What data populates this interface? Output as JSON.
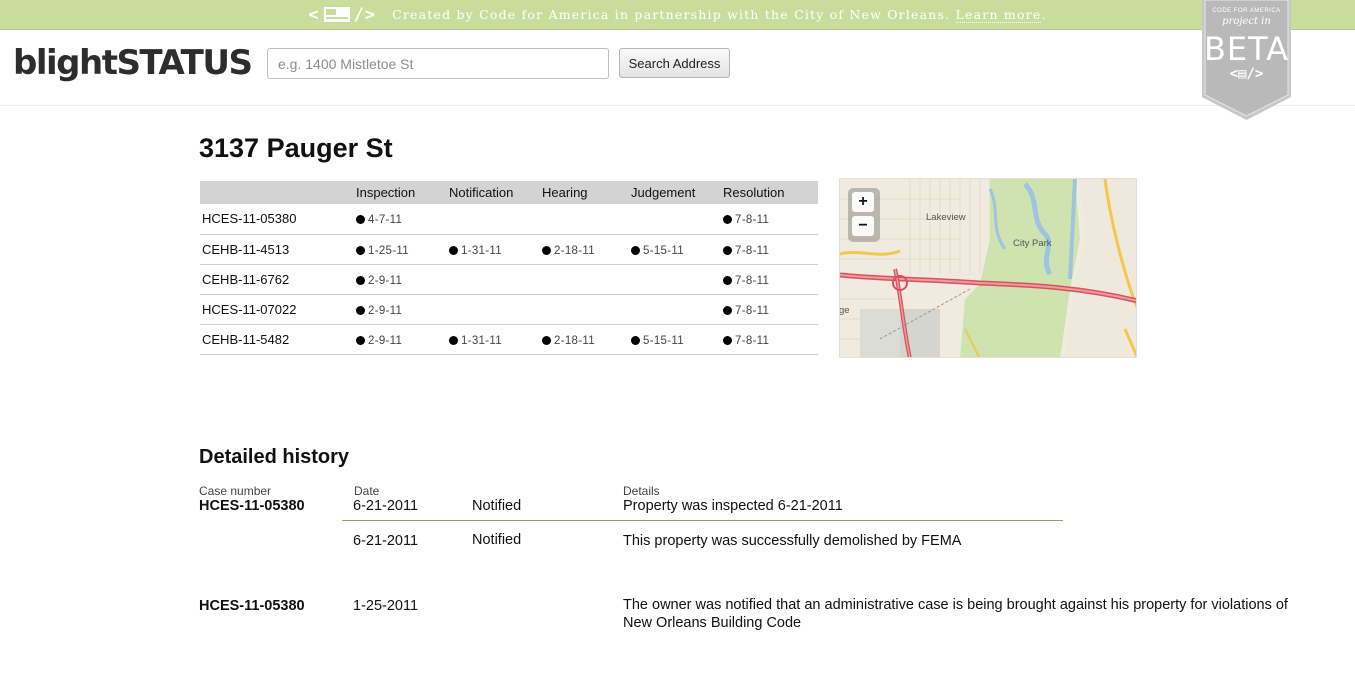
{
  "banner": {
    "tagline_text": "Created by Code for America in partnership with the City of New Orleans.",
    "learn_more": "Learn more",
    "period": ".",
    "color": "#c8dd9c"
  },
  "header": {
    "logo": "blightSTATUS",
    "search_placeholder": "e.g. 1400 Mistletoe St",
    "search_button": "Search Address"
  },
  "beta_badge": {
    "line1": "CODE FOR AMERICA",
    "line2": "project in",
    "line3": "BETA"
  },
  "address": "3137 Pauger St",
  "status_table": {
    "headers": [
      "",
      "Inspection",
      "Notification",
      "Hearing",
      "Judgement",
      "Resolution"
    ],
    "rows": [
      {
        "case": "HCES-11-05380",
        "steps": [
          "4-7-11",
          "",
          "",
          "",
          "7-8-11"
        ]
      },
      {
        "case": "CEHB-11-4513",
        "steps": [
          "1-25-11",
          "1-31-11",
          "2-18-11",
          "5-15-11",
          "7-8-11"
        ]
      },
      {
        "case": "CEHB-11-6762",
        "steps": [
          "2-9-11",
          "",
          "",
          "",
          "7-8-11"
        ]
      },
      {
        "case": "HCES-11-07022",
        "steps": [
          "2-9-11",
          "",
          "",
          "",
          "7-8-11"
        ]
      },
      {
        "case": "CEHB-11-5482",
        "steps": [
          "2-9-11",
          "1-31-11",
          "2-18-11",
          "5-15-11",
          "7-8-11"
        ]
      }
    ]
  },
  "map": {
    "labels": {
      "lakeview": "Lakeview",
      "city_park": "City Park",
      "edge": "ge"
    },
    "zoom_in": "+",
    "zoom_out": "−"
  },
  "history": {
    "title": "Detailed history",
    "col_case": "Case number",
    "col_date": "Date",
    "col_details": "Details",
    "entries": [
      {
        "case": "HCES-11-05380",
        "date": "6-21-2011",
        "status": "Notified",
        "details": "Property was inspected 6-21-2011"
      },
      {
        "case": "",
        "date": "6-21-2011",
        "status": "Notified",
        "details": "This property was successfully demolished by FEMA"
      },
      {
        "case": "HCES-11-05380",
        "date": "1-25-2011",
        "status": "",
        "details": "The owner was notified that an administrative case is being brought against his property for violations of New Orleans Building Code"
      }
    ]
  }
}
